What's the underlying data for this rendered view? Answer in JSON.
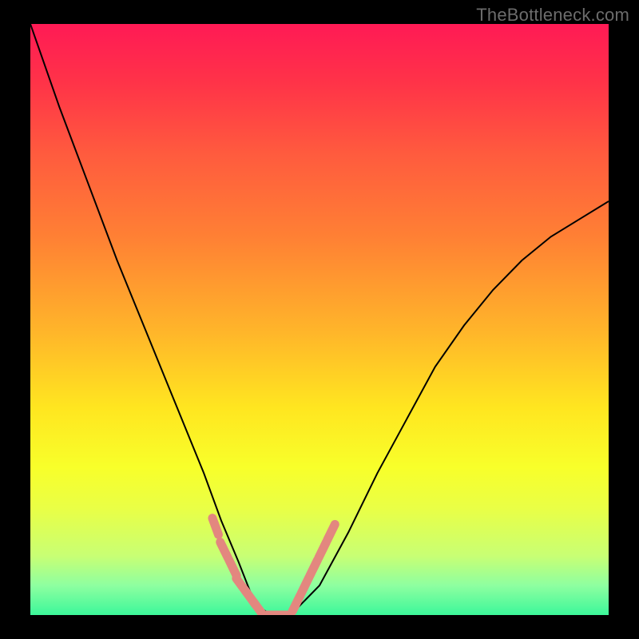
{
  "watermark": "TheBottleneck.com",
  "chart_data": {
    "type": "line",
    "title": "",
    "xlabel": "",
    "ylabel": "",
    "xlim": [
      0,
      100
    ],
    "ylim": [
      0,
      100
    ],
    "series": [
      {
        "name": "curve",
        "x": [
          0,
          5,
          10,
          15,
          20,
          25,
          30,
          33,
          36,
          38,
          40,
          42,
          44,
          46,
          50,
          55,
          60,
          65,
          70,
          75,
          80,
          85,
          90,
          95,
          100
        ],
        "y": [
          100,
          86,
          73,
          60,
          48,
          36,
          24,
          16,
          9,
          4,
          1,
          0,
          0,
          1,
          5,
          14,
          24,
          33,
          42,
          49,
          55,
          60,
          64,
          67,
          70
        ]
      },
      {
        "name": "highlight-left",
        "x": [
          32,
          33.5,
          35,
          36.5,
          38,
          39.5
        ],
        "y": [
          15,
          11,
          8,
          5,
          3,
          1
        ]
      },
      {
        "name": "highlight-right",
        "x": [
          46,
          47.5,
          49,
          50.5,
          52
        ],
        "y": [
          2,
          5,
          8,
          11,
          14
        ]
      }
    ],
    "colors": {
      "curve": "#000000",
      "highlight": "#e3877f"
    }
  }
}
